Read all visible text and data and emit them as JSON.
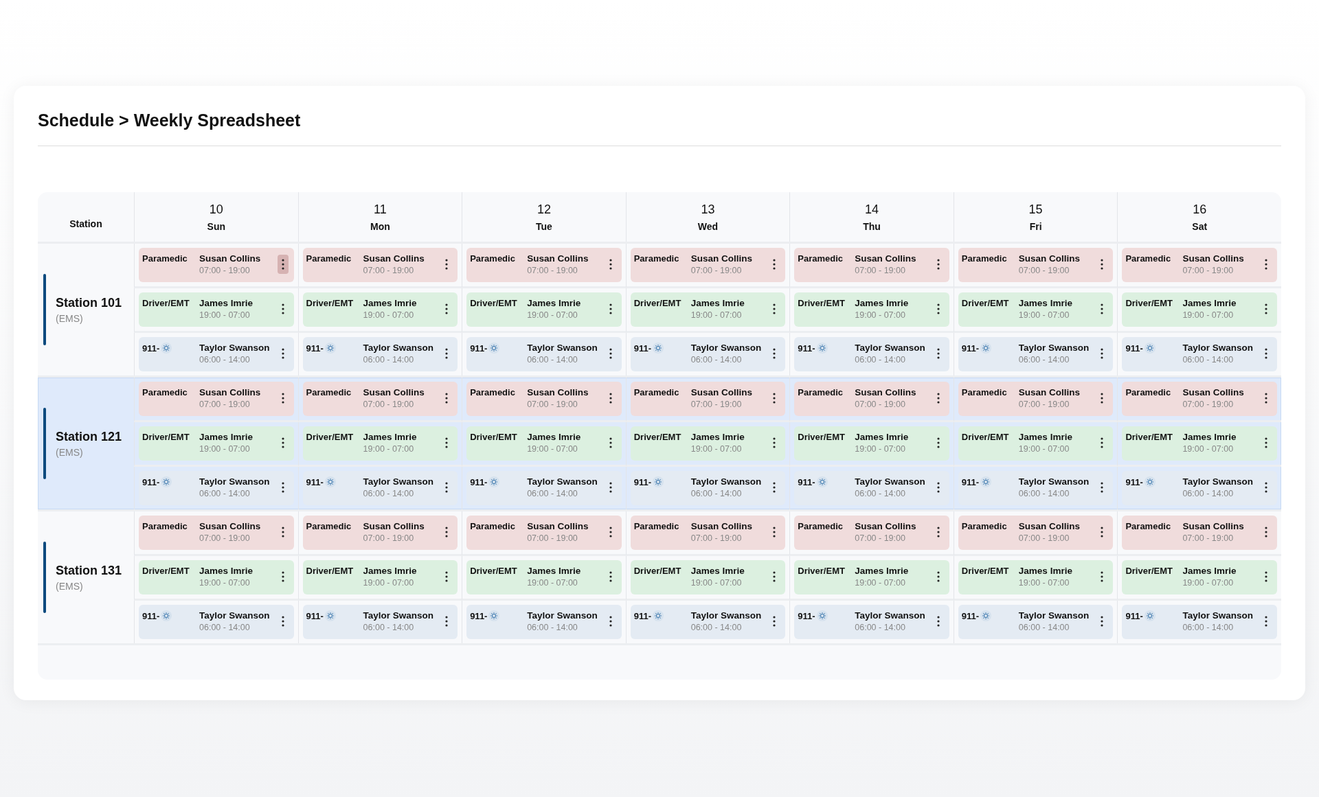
{
  "breadcrumb": "Schedule > Weekly Spreadsheet",
  "table": {
    "station_header": "Station",
    "days": [
      {
        "date": "10",
        "weekday": "Sun"
      },
      {
        "date": "11",
        "weekday": "Mon"
      },
      {
        "date": "12",
        "weekday": "Tue"
      },
      {
        "date": "13",
        "weekday": "Wed"
      },
      {
        "date": "14",
        "weekday": "Thu"
      },
      {
        "date": "15",
        "weekday": "Fri"
      },
      {
        "date": "16",
        "weekday": "Sat"
      }
    ],
    "stations": [
      {
        "name": "Station 101",
        "type": "(EMS)",
        "highlighted": false,
        "rows": [
          {
            "kind": "paramedic",
            "cells": [
              {
                "role": "Paramedic",
                "name": "Susan Collins",
                "time": "07:00 - 19:00",
                "menu_active": true
              },
              {
                "role": "Paramedic",
                "name": "Susan Collins",
                "time": "07:00 - 19:00",
                "menu_active": false
              },
              {
                "role": "Paramedic",
                "name": "Susan Collins",
                "time": "07:00 - 19:00",
                "menu_active": false
              },
              {
                "role": "Paramedic",
                "name": "Susan Collins",
                "time": "07:00 - 19:00",
                "menu_active": false
              },
              {
                "role": "Paramedic",
                "name": "Susan Collins",
                "time": "07:00 - 19:00",
                "menu_active": false
              },
              {
                "role": "Paramedic",
                "name": "Susan Collins",
                "time": "07:00 - 19:00",
                "menu_active": false
              },
              {
                "role": "Paramedic",
                "name": "Susan Collins",
                "time": "07:00 - 19:00",
                "menu_active": false
              }
            ]
          },
          {
            "kind": "driver",
            "cells": [
              {
                "role": "Driver/EMT",
                "name": "James Imrie",
                "time": "19:00 - 07:00",
                "menu_active": false
              },
              {
                "role": "Driver/EMT",
                "name": "James Imrie",
                "time": "19:00 - 07:00",
                "menu_active": false
              },
              {
                "role": "Driver/EMT",
                "name": "James Imrie",
                "time": "19:00 - 07:00",
                "menu_active": false
              },
              {
                "role": "Driver/EMT",
                "name": "James Imrie",
                "time": "19:00 - 07:00",
                "menu_active": false
              },
              {
                "role": "Driver/EMT",
                "name": "James Imrie",
                "time": "19:00 - 07:00",
                "menu_active": false
              },
              {
                "role": "Driver/EMT",
                "name": "James Imrie",
                "time": "19:00 - 07:00",
                "menu_active": false
              },
              {
                "role": "Driver/EMT",
                "name": "James Imrie",
                "time": "19:00 - 07:00",
                "menu_active": false
              }
            ]
          },
          {
            "kind": "dispatch",
            "cells": [
              {
                "role": "911-",
                "name": "Taylor Swanson",
                "time": "06:00 - 14:00",
                "menu_active": false
              },
              {
                "role": "911-",
                "name": "Taylor Swanson",
                "time": "06:00 - 14:00",
                "menu_active": false
              },
              {
                "role": "911-",
                "name": "Taylor Swanson",
                "time": "06:00 - 14:00",
                "menu_active": false
              },
              {
                "role": "911-",
                "name": "Taylor Swanson",
                "time": "06:00 - 14:00",
                "menu_active": false
              },
              {
                "role": "911-",
                "name": "Taylor Swanson",
                "time": "06:00 - 14:00",
                "menu_active": false
              },
              {
                "role": "911-",
                "name": "Taylor Swanson",
                "time": "06:00 - 14:00",
                "menu_active": false
              },
              {
                "role": "911-",
                "name": "Taylor Swanson",
                "time": "06:00 - 14:00",
                "menu_active": false
              }
            ]
          }
        ]
      },
      {
        "name": "Station 121",
        "type": "(EMS)",
        "highlighted": true,
        "rows": [
          {
            "kind": "paramedic",
            "cells": [
              {
                "role": "Paramedic",
                "name": "Susan Collins",
                "time": "07:00 - 19:00",
                "menu_active": false
              },
              {
                "role": "Paramedic",
                "name": "Susan Collins",
                "time": "07:00 - 19:00",
                "menu_active": false
              },
              {
                "role": "Paramedic",
                "name": "Susan Collins",
                "time": "07:00 - 19:00",
                "menu_active": false
              },
              {
                "role": "Paramedic",
                "name": "Susan Collins",
                "time": "07:00 - 19:00",
                "menu_active": false
              },
              {
                "role": "Paramedic",
                "name": "Susan Collins",
                "time": "07:00 - 19:00",
                "menu_active": false
              },
              {
                "role": "Paramedic",
                "name": "Susan Collins",
                "time": "07:00 - 19:00",
                "menu_active": false
              },
              {
                "role": "Paramedic",
                "name": "Susan Collins",
                "time": "07:00 - 19:00",
                "menu_active": false
              }
            ]
          },
          {
            "kind": "driver",
            "cells": [
              {
                "role": "Driver/EMT",
                "name": "James Imrie",
                "time": "19:00 - 07:00",
                "menu_active": false
              },
              {
                "role": "Driver/EMT",
                "name": "James Imrie",
                "time": "19:00 - 07:00",
                "menu_active": false
              },
              {
                "role": "Driver/EMT",
                "name": "James Imrie",
                "time": "19:00 - 07:00",
                "menu_active": false
              },
              {
                "role": "Driver/EMT",
                "name": "James Imrie",
                "time": "19:00 - 07:00",
                "menu_active": false
              },
              {
                "role": "Driver/EMT",
                "name": "James Imrie",
                "time": "19:00 - 07:00",
                "menu_active": false
              },
              {
                "role": "Driver/EMT",
                "name": "James Imrie",
                "time": "19:00 - 07:00",
                "menu_active": false
              },
              {
                "role": "Driver/EMT",
                "name": "James Imrie",
                "time": "19:00 - 07:00",
                "menu_active": false
              }
            ]
          },
          {
            "kind": "dispatch",
            "cells": [
              {
                "role": "911-",
                "name": "Taylor Swanson",
                "time": "06:00 - 14:00",
                "menu_active": false
              },
              {
                "role": "911-",
                "name": "Taylor Swanson",
                "time": "06:00 - 14:00",
                "menu_active": false
              },
              {
                "role": "911-",
                "name": "Taylor Swanson",
                "time": "06:00 - 14:00",
                "menu_active": false
              },
              {
                "role": "911-",
                "name": "Taylor Swanson",
                "time": "06:00 - 14:00",
                "menu_active": false
              },
              {
                "role": "911-",
                "name": "Taylor Swanson",
                "time": "06:00 - 14:00",
                "menu_active": false
              },
              {
                "role": "911-",
                "name": "Taylor Swanson",
                "time": "06:00 - 14:00",
                "menu_active": false
              },
              {
                "role": "911-",
                "name": "Taylor Swanson",
                "time": "06:00 - 14:00",
                "menu_active": false
              }
            ]
          }
        ]
      },
      {
        "name": "Station 131",
        "type": "(EMS)",
        "highlighted": false,
        "rows": [
          {
            "kind": "paramedic",
            "cells": [
              {
                "role": "Paramedic",
                "name": "Susan Collins",
                "time": "07:00 - 19:00",
                "menu_active": false
              },
              {
                "role": "Paramedic",
                "name": "Susan Collins",
                "time": "07:00 - 19:00",
                "menu_active": false
              },
              {
                "role": "Paramedic",
                "name": "Susan Collins",
                "time": "07:00 - 19:00",
                "menu_active": false
              },
              {
                "role": "Paramedic",
                "name": "Susan Collins",
                "time": "07:00 - 19:00",
                "menu_active": false
              },
              {
                "role": "Paramedic",
                "name": "Susan Collins",
                "time": "07:00 - 19:00",
                "menu_active": false
              },
              {
                "role": "Paramedic",
                "name": "Susan Collins",
                "time": "07:00 - 19:00",
                "menu_active": false
              },
              {
                "role": "Paramedic",
                "name": "Susan Collins",
                "time": "07:00 - 19:00",
                "menu_active": false
              }
            ]
          },
          {
            "kind": "driver",
            "cells": [
              {
                "role": "Driver/EMT",
                "name": "James Imrie",
                "time": "19:00 - 07:00",
                "menu_active": false
              },
              {
                "role": "Driver/EMT",
                "name": "James Imrie",
                "time": "19:00 - 07:00",
                "menu_active": false
              },
              {
                "role": "Driver/EMT",
                "name": "James Imrie",
                "time": "19:00 - 07:00",
                "menu_active": false
              },
              {
                "role": "Driver/EMT",
                "name": "James Imrie",
                "time": "19:00 - 07:00",
                "menu_active": false
              },
              {
                "role": "Driver/EMT",
                "name": "James Imrie",
                "time": "19:00 - 07:00",
                "menu_active": false
              },
              {
                "role": "Driver/EMT",
                "name": "James Imrie",
                "time": "19:00 - 07:00",
                "menu_active": false
              },
              {
                "role": "Driver/EMT",
                "name": "James Imrie",
                "time": "19:00 - 07:00",
                "menu_active": false
              }
            ]
          },
          {
            "kind": "dispatch",
            "cells": [
              {
                "role": "911-",
                "name": "Taylor Swanson",
                "time": "06:00 - 14:00",
                "menu_active": false
              },
              {
                "role": "911-",
                "name": "Taylor Swanson",
                "time": "06:00 - 14:00",
                "menu_active": false
              },
              {
                "role": "911-",
                "name": "Taylor Swanson",
                "time": "06:00 - 14:00",
                "menu_active": false
              },
              {
                "role": "911-",
                "name": "Taylor Swanson",
                "time": "06:00 - 14:00",
                "menu_active": false
              },
              {
                "role": "911-",
                "name": "Taylor Swanson",
                "time": "06:00 - 14:00",
                "menu_active": false
              },
              {
                "role": "911-",
                "name": "Taylor Swanson",
                "time": "06:00 - 14:00",
                "menu_active": false
              },
              {
                "role": "911-",
                "name": "Taylor Swanson",
                "time": "06:00 - 14:00",
                "menu_active": false
              }
            ]
          }
        ]
      }
    ]
  }
}
